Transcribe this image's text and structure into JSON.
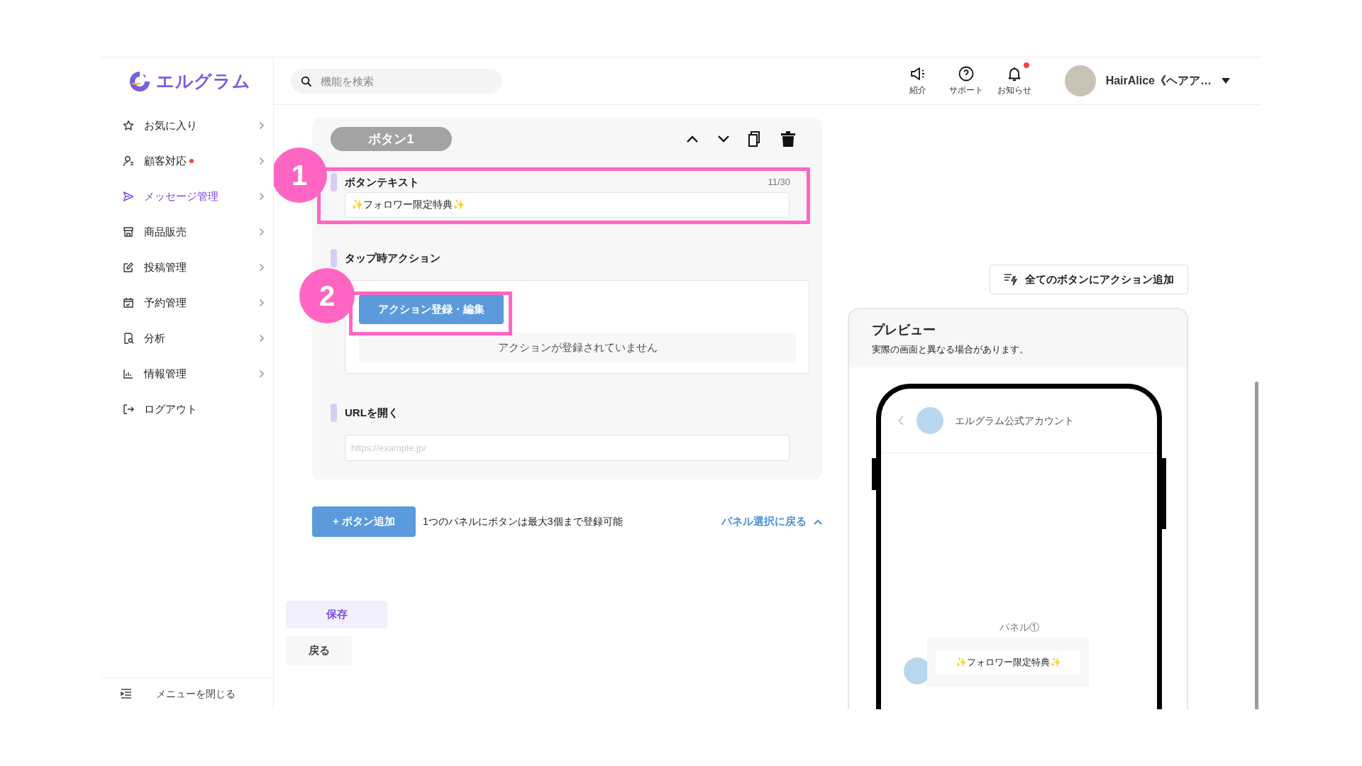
{
  "logo": {
    "text": "エルグラム"
  },
  "search": {
    "placeholder": "機能を検索"
  },
  "header_links": [
    {
      "label": "紹介",
      "notification": false
    },
    {
      "label": "サポート",
      "notification": false
    },
    {
      "label": "お知らせ",
      "notification": true
    }
  ],
  "account": {
    "name": "HairAlice《ヘアア…"
  },
  "sidebar": {
    "items": [
      {
        "label": "お気に入り",
        "selected": false,
        "notification": false,
        "has_submenu": true
      },
      {
        "label": "顧客対応",
        "selected": false,
        "notification": true,
        "has_submenu": true
      },
      {
        "label": "メッセージ管理",
        "selected": true,
        "notification": false,
        "has_submenu": true
      },
      {
        "label": "商品販売",
        "selected": false,
        "notification": false,
        "has_submenu": true
      },
      {
        "label": "投稿管理",
        "selected": false,
        "notification": false,
        "has_submenu": true
      },
      {
        "label": "予約管理",
        "selected": false,
        "notification": false,
        "has_submenu": true
      },
      {
        "label": "分析",
        "selected": false,
        "notification": false,
        "has_submenu": true
      },
      {
        "label": "情報管理",
        "selected": false,
        "notification": false,
        "has_submenu": true
      },
      {
        "label": "ログアウト",
        "selected": false,
        "notification": false,
        "has_submenu": false
      }
    ],
    "collapse": "メニューを閉じる"
  },
  "editor": {
    "button_tab": "ボタン1",
    "button_text": {
      "label": "ボタンテキスト",
      "counter": "11/30",
      "value": "✨フォロワー限定特典✨"
    },
    "tap_action": {
      "label": "タップ時アクション",
      "button": "アクション登録・編集",
      "empty_message": "アクションが登録されていません"
    },
    "url": {
      "label": "URLを開く",
      "placeholder": "https://example.jp/"
    },
    "callouts": [
      "1",
      "2"
    ],
    "add_button": "+ ボタン追加",
    "limit_note": "1つのパネルにボタンは最大3個まで登録可能",
    "back_to_panels": "パネル選択に戻る",
    "save": "保存",
    "back": "戻る"
  },
  "preview": {
    "add_all_button": "全てのボタンにアクション追加",
    "title": "プレビュー",
    "note": "実際の画面と異なる場合があります。",
    "account_name": "エルグラム公式アカウント",
    "panel_label": "パネル①",
    "message_button": "✨フォロワー限定特典✨"
  }
}
